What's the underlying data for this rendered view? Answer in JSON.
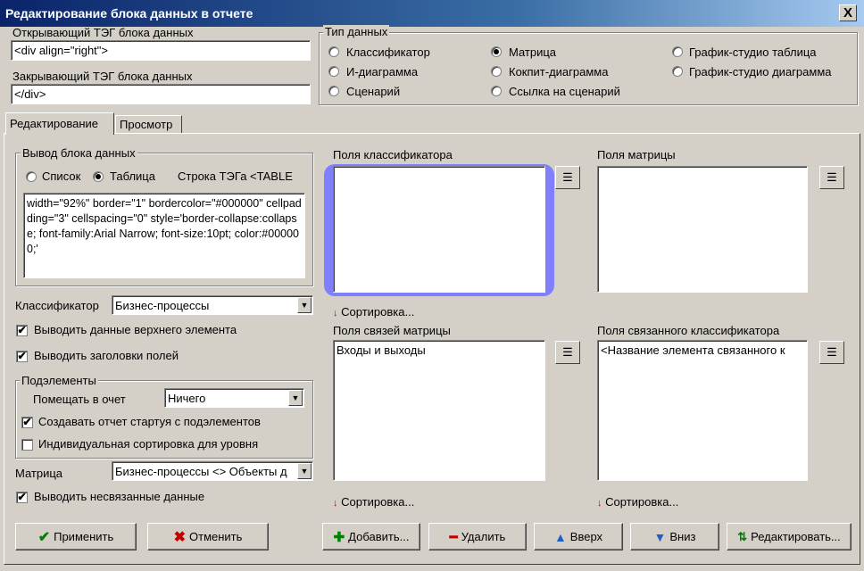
{
  "window": {
    "title": "Редактирование блока данных в отчете",
    "close_label": "X"
  },
  "tags": {
    "open_label": "Открывающий ТЭГ блока данных",
    "open_value": "<div align=\"right\">",
    "close_label": "Закрывающий ТЭГ блока данных",
    "close_value": "</div>"
  },
  "data_type": {
    "title": "Тип данных",
    "options": [
      {
        "label": "Классификатор",
        "selected": false
      },
      {
        "label": "Матрица",
        "selected": true
      },
      {
        "label": "График-студио таблица",
        "selected": false
      },
      {
        "label": "И-диаграмма",
        "selected": false
      },
      {
        "label": "Кокпит-диаграмма",
        "selected": false
      },
      {
        "label": "График-студио диаграмма",
        "selected": false
      },
      {
        "label": "Сценарий",
        "selected": false
      },
      {
        "label": "Ссылка на сценарий",
        "selected": false
      }
    ]
  },
  "tabs": [
    {
      "label": "Редактирование",
      "active": true
    },
    {
      "label": "Просмотр",
      "active": false
    }
  ],
  "output": {
    "title": "Вывод блока данных",
    "list_label": "Список",
    "table_label": "Таблица",
    "table_selected": true,
    "tag_row_label": "Строка ТЭГа <TABLE",
    "table_attrs": "width=\"92%\" border=\"1\" bordercolor=\"#000000\" cellpadding=\"3\" cellspacing=\"0\"  style='border-collapse:collapse; font-family:Arial Narrow; font-size:10pt; color:#000000;'"
  },
  "classifier": {
    "label": "Классификатор",
    "value": "Бизнес-процессы"
  },
  "checks": {
    "top_element": {
      "label": "Выводить данные верхнего элемента",
      "checked": true
    },
    "field_headers": {
      "label": "Выводить заголовки полей",
      "checked": true
    },
    "unlinked": {
      "label": "Выводить несвязанные данные",
      "checked": true
    }
  },
  "subelements": {
    "title": "Подэлементы",
    "place_label": "Помещать в очет",
    "place_value": "Ничего",
    "create_from_sub": {
      "label": "Создавать отчет стартуя с подэлементов",
      "checked": true
    },
    "individual_sort": {
      "label": "Индивидуальная сортировка для уровня",
      "checked": false
    }
  },
  "matrix": {
    "label": "Матрица",
    "value": "Бизнес-процессы <> Объекты д"
  },
  "fields": {
    "classifier_fields": {
      "label": "Поля классификатора",
      "items": []
    },
    "matrix_fields": {
      "label": "Поля матрицы",
      "items": []
    },
    "matrix_link_fields": {
      "label": "Поля связей матрицы",
      "items": [
        "Входы и выходы"
      ]
    },
    "linked_classifier_fields": {
      "label": "Поля связанного классификатора",
      "items": [
        "<Название элемента связанного к"
      ]
    },
    "sort_label": "Сортировка..."
  },
  "buttons": {
    "apply": "Применить",
    "cancel": "Отменить",
    "add": "Добавить...",
    "delete": "Удалить",
    "up": "Вверх",
    "down": "Вниз",
    "edit": "Редактировать..."
  },
  "colors": {
    "title_start": "#0a246a",
    "title_end": "#a6caf0",
    "selection_frame": "#8080ff",
    "apply_icon": "#008000",
    "cancel_icon": "#c00000"
  }
}
